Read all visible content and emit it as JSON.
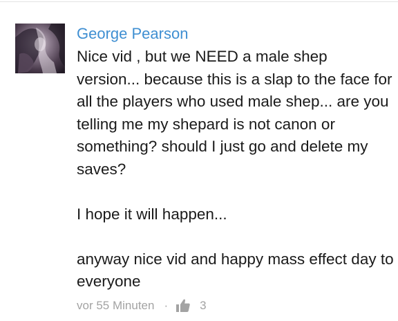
{
  "comment": {
    "author": "George Pearson",
    "avatar_icon": "user-avatar",
    "paragraphs": [
      "Nice vid , but we NEED a male shep version... because this is a slap to the face for all the players who used male shep... are you telling me my shepard is not canon or something? should I just go and delete my saves?",
      "I hope it will happen...",
      "anyway nice vid and happy mass effect day to everyone"
    ],
    "timestamp": "vor 55 Minuten",
    "separator": "·",
    "like_icon": "thumbs-up-icon",
    "like_count": "3"
  },
  "colors": {
    "author": "#3f8fd2",
    "text": "#1a1a1a",
    "meta": "#a3a3a3"
  }
}
